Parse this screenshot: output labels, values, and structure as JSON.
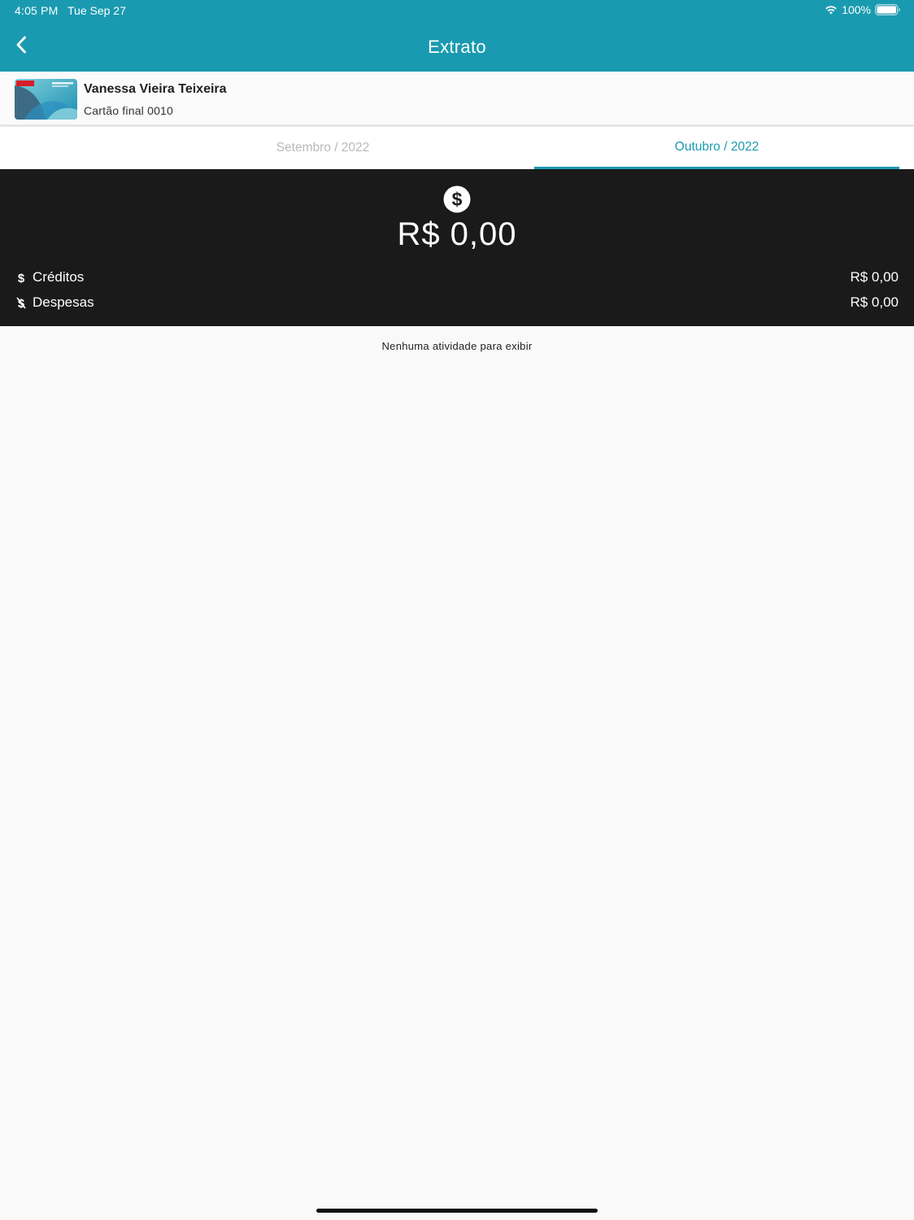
{
  "status_bar": {
    "time": "4:05 PM",
    "date": "Tue Sep 27",
    "battery_percent": "100%",
    "icons": [
      "wifi-icon",
      "battery-icon"
    ]
  },
  "nav": {
    "title": "Extrato",
    "back_icon": "chevron-left-icon"
  },
  "card": {
    "holder_name": "Vanessa Vieira Teixeira",
    "final_label": "Cartão final 0010"
  },
  "tabs": [
    {
      "label": "Setembro / 2022",
      "active": false
    },
    {
      "label": "Outubro / 2022",
      "active": true
    }
  ],
  "summary": {
    "icon": "dollar-circle-icon",
    "balance": "R$  0,00",
    "rows": [
      {
        "label": "Créditos",
        "value": "R$  0,00",
        "icon": "dollar-icon"
      },
      {
        "label": "Despesas",
        "value": "R$  0,00",
        "icon": "dollar-slash-icon"
      }
    ]
  },
  "empty_message": "Nenhuma atividade para exibir",
  "colors": {
    "primary": "#1a9ab0",
    "summary_bg": "#1a1a1a",
    "inactive_tab": "#b9b9b9",
    "page_bg": "#f9f9f9"
  }
}
